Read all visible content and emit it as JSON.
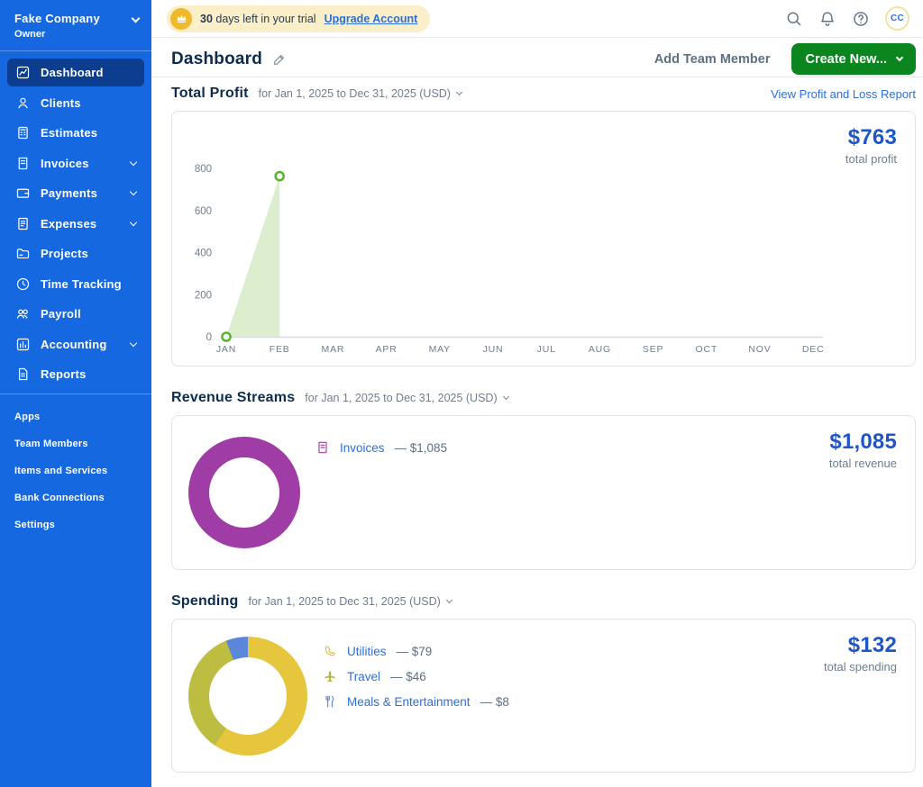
{
  "sidebar": {
    "company": "Fake Company",
    "role": "Owner",
    "items": [
      {
        "label": "Dashboard",
        "icon": "dashboard",
        "active": true,
        "expandable": false
      },
      {
        "label": "Clients",
        "icon": "clients",
        "active": false,
        "expandable": false
      },
      {
        "label": "Estimates",
        "icon": "estimates",
        "active": false,
        "expandable": false
      },
      {
        "label": "Invoices",
        "icon": "invoices",
        "active": false,
        "expandable": true
      },
      {
        "label": "Payments",
        "icon": "payments",
        "active": false,
        "expandable": true
      },
      {
        "label": "Expenses",
        "icon": "expenses",
        "active": false,
        "expandable": true
      },
      {
        "label": "Projects",
        "icon": "projects",
        "active": false,
        "expandable": false
      },
      {
        "label": "Time Tracking",
        "icon": "time-tracking",
        "active": false,
        "expandable": false
      },
      {
        "label": "Payroll",
        "icon": "payroll",
        "active": false,
        "expandable": false
      },
      {
        "label": "Accounting",
        "icon": "accounting",
        "active": false,
        "expandable": true
      },
      {
        "label": "Reports",
        "icon": "reports",
        "active": false,
        "expandable": false
      }
    ],
    "secondary": [
      "Apps",
      "Team Members",
      "Items and Services",
      "Bank Connections",
      "Settings"
    ]
  },
  "topbar": {
    "trial_days": "30",
    "trial_text": "days left in your trial",
    "upgrade_label": "Upgrade Account",
    "icons": [
      "search",
      "bell",
      "help"
    ],
    "avatar_initials": "CC"
  },
  "header": {
    "title": "Dashboard",
    "add_team_member_label": "Add Team Member",
    "create_new_label": "Create New..."
  },
  "profit_section": {
    "title": "Total Profit",
    "date_range": "for Jan 1, 2025 to Dec 31, 2025 (USD)",
    "report_link": "View Profit and Loss Report",
    "total_value": "$763",
    "total_label": "total profit"
  },
  "revenue_section": {
    "title": "Revenue Streams",
    "date_range": "for Jan 1, 2025 to Dec 31, 2025 (USD)",
    "total_value": "$1,085",
    "total_label": "total revenue",
    "legend": [
      {
        "icon": "invoice",
        "label": "Invoices",
        "amount": "$1,085",
        "color": "#A03CA5"
      }
    ]
  },
  "spending_section": {
    "title": "Spending",
    "date_range": "for Jan 1, 2025 to Dec 31, 2025 (USD)",
    "total_value": "$132",
    "total_label": "total spending",
    "legend": [
      {
        "icon": "phone",
        "label": "Utilities",
        "amount": "$79",
        "color": "#E0BE3B"
      },
      {
        "icon": "plane",
        "label": "Travel",
        "amount": "$46",
        "color": "#B4B73F"
      },
      {
        "icon": "utensils",
        "label": "Meals & Entertainment",
        "amount": "$8",
        "color": "#5B87DB"
      }
    ]
  },
  "chart_data": [
    {
      "type": "area",
      "title": "Total Profit",
      "x": [
        "JAN",
        "FEB",
        "MAR",
        "APR",
        "MAY",
        "JUN",
        "JUL",
        "AUG",
        "SEP",
        "OCT",
        "NOV",
        "DEC"
      ],
      "series": [
        {
          "name": "Profit",
          "values": [
            0,
            763,
            null,
            null,
            null,
            null,
            null,
            null,
            null,
            null,
            null,
            null
          ]
        }
      ],
      "ylim": [
        0,
        800
      ],
      "yticks": [
        0,
        200,
        400,
        600,
        800
      ],
      "grid": false,
      "legend_position": "none",
      "area_color": "#DCEECD",
      "marker_color": "#55B22F",
      "axis_text_color": "#6F7D8F"
    },
    {
      "type": "pie",
      "title": "Revenue Streams",
      "labels": [
        "Invoices"
      ],
      "values": [
        1085
      ],
      "colors": [
        "#A03CA5"
      ],
      "donut": true,
      "total": 1085
    },
    {
      "type": "pie",
      "title": "Spending",
      "labels": [
        "Utilities",
        "Travel",
        "Meals & Entertainment"
      ],
      "values": [
        79,
        46,
        8
      ],
      "colors": [
        "#E6C63D",
        "#BCBD41",
        "#5B87DB"
      ],
      "donut": true,
      "total": 132
    }
  ]
}
